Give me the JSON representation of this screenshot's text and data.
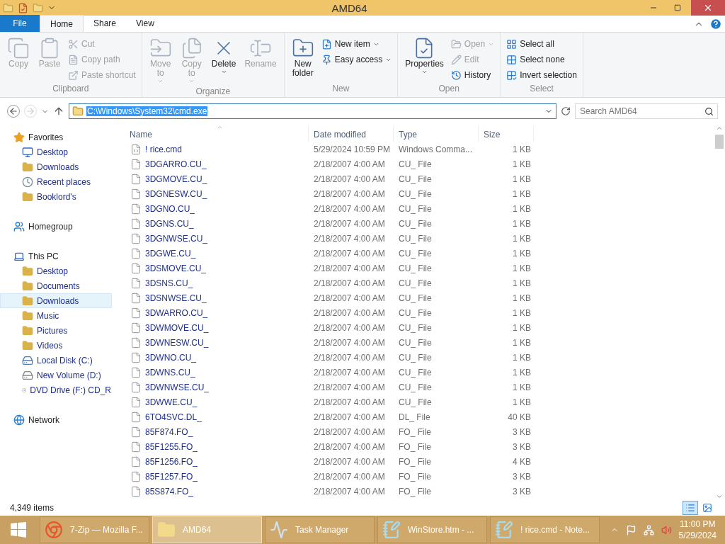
{
  "window": {
    "title": "AMD64"
  },
  "ribbon_tabs": [
    {
      "label": "File",
      "kind": "file",
      "selected": false
    },
    {
      "label": "Home",
      "kind": "tab",
      "selected": true
    },
    {
      "label": "Share",
      "kind": "tab",
      "selected": false
    },
    {
      "label": "View",
      "kind": "tab",
      "selected": false
    }
  ],
  "ribbon_groups": [
    {
      "label": "Clipboard",
      "items": [
        {
          "label": "Copy",
          "kind": "large",
          "disabled": true,
          "dropdown": false
        },
        {
          "label": "Paste",
          "kind": "large",
          "disabled": true,
          "dropdown": false
        },
        {
          "kind": "stack",
          "items": [
            {
              "label": "Cut",
              "disabled": true,
              "dropdown": false
            },
            {
              "label": "Copy path",
              "disabled": true,
              "dropdown": false
            },
            {
              "label": "Paste shortcut",
              "disabled": true,
              "dropdown": false
            }
          ]
        }
      ]
    },
    {
      "label": "Organize",
      "items": [
        {
          "label": "Move\nto",
          "kind": "large",
          "disabled": true,
          "dropdown": true
        },
        {
          "label": "Copy\nto",
          "kind": "large",
          "disabled": true,
          "dropdown": true
        },
        {
          "label": "Delete",
          "kind": "large",
          "disabled": false,
          "dropdown": true
        },
        {
          "label": "Rename",
          "kind": "large",
          "disabled": true,
          "dropdown": false
        }
      ]
    },
    {
      "label": "New",
      "items": [
        {
          "label": "New\nfolder",
          "kind": "large",
          "disabled": false,
          "dropdown": false
        },
        {
          "kind": "stack",
          "items": [
            {
              "label": "New item",
              "disabled": false,
              "dropdown": true
            },
            {
              "label": "Easy access",
              "disabled": false,
              "dropdown": true
            }
          ]
        }
      ]
    },
    {
      "label": "Open",
      "items": [
        {
          "label": "Properties",
          "kind": "large",
          "disabled": false,
          "dropdown": true
        },
        {
          "kind": "stack",
          "items": [
            {
              "label": "Open",
              "disabled": true,
              "dropdown": true
            },
            {
              "label": "Edit",
              "disabled": true,
              "dropdown": false
            },
            {
              "label": "History",
              "disabled": false,
              "dropdown": false
            }
          ]
        }
      ]
    },
    {
      "label": "Select",
      "items": [
        {
          "kind": "stack",
          "items": [
            {
              "label": "Select all",
              "disabled": false,
              "dropdown": false
            },
            {
              "label": "Select none",
              "disabled": false,
              "dropdown": false
            },
            {
              "label": "Invert selection",
              "disabled": false,
              "dropdown": false
            }
          ]
        }
      ]
    }
  ],
  "address": {
    "value": "C:\\Windows\\System32\\cmd.exe",
    "text_selected": true
  },
  "search": {
    "placeholder": "Search AMD64"
  },
  "nav": [
    {
      "label": "Favorites",
      "kind": "star",
      "selected": false,
      "children": [
        {
          "label": "Desktop",
          "kind": "desktop",
          "selected": false
        },
        {
          "label": "Downloads",
          "kind": "folder",
          "selected": false
        },
        {
          "label": "Recent places",
          "kind": "recent",
          "selected": false
        },
        {
          "label": "Booklord's",
          "kind": "folder",
          "selected": false
        }
      ]
    },
    {
      "label": "Homegroup",
      "kind": "homegroup",
      "selected": false
    },
    {
      "label": "This PC",
      "kind": "pc",
      "selected": false,
      "children": [
        {
          "label": "Desktop",
          "kind": "folder",
          "selected": false
        },
        {
          "label": "Documents",
          "kind": "folder",
          "selected": false
        },
        {
          "label": "Downloads",
          "kind": "folder",
          "selected": true
        },
        {
          "label": "Music",
          "kind": "folder",
          "selected": false
        },
        {
          "label": "Pictures",
          "kind": "folder",
          "selected": false
        },
        {
          "label": "Videos",
          "kind": "folder",
          "selected": false
        },
        {
          "label": "Local Disk (C:)",
          "kind": "disk",
          "selected": false
        },
        {
          "label": "New Volume (D:)",
          "kind": "drive",
          "selected": false
        },
        {
          "label": "DVD Drive (F:) CD_R",
          "kind": "dvd",
          "selected": false
        }
      ]
    },
    {
      "label": "Network",
      "kind": "network",
      "selected": false
    }
  ],
  "table": {
    "columns": [
      {
        "label": "Name",
        "sorted": true
      },
      {
        "label": "Date modified",
        "sorted": false
      },
      {
        "label": "Type",
        "sorted": false
      },
      {
        "label": "Size",
        "sorted": false
      }
    ],
    "rows": [
      {
        "kind": "script",
        "name": "! rice.cmd",
        "date": "5/29/2024 10:59 PM",
        "type": "Windows Comma...",
        "size": "1 KB"
      },
      {
        "kind": "file",
        "name": "3DGARRO.CU_",
        "date": "2/18/2007 4:00 AM",
        "type": "CU_ File",
        "size": "1 KB"
      },
      {
        "kind": "file",
        "name": "3DGMOVE.CU_",
        "date": "2/18/2007 4:00 AM",
        "type": "CU_ File",
        "size": "1 KB"
      },
      {
        "kind": "file",
        "name": "3DGNESW.CU_",
        "date": "2/18/2007 4:00 AM",
        "type": "CU_ File",
        "size": "1 KB"
      },
      {
        "kind": "file",
        "name": "3DGNO.CU_",
        "date": "2/18/2007 4:00 AM",
        "type": "CU_ File",
        "size": "1 KB"
      },
      {
        "kind": "file",
        "name": "3DGNS.CU_",
        "date": "2/18/2007 4:00 AM",
        "type": "CU_ File",
        "size": "1 KB"
      },
      {
        "kind": "file",
        "name": "3DGNWSE.CU_",
        "date": "2/18/2007 4:00 AM",
        "type": "CU_ File",
        "size": "1 KB"
      },
      {
        "kind": "file",
        "name": "3DGWE.CU_",
        "date": "2/18/2007 4:00 AM",
        "type": "CU_ File",
        "size": "1 KB"
      },
      {
        "kind": "file",
        "name": "3DSMOVE.CU_",
        "date": "2/18/2007 4:00 AM",
        "type": "CU_ File",
        "size": "1 KB"
      },
      {
        "kind": "file",
        "name": "3DSNS.CU_",
        "date": "2/18/2007 4:00 AM",
        "type": "CU_ File",
        "size": "1 KB"
      },
      {
        "kind": "file",
        "name": "3DSNWSE.CU_",
        "date": "2/18/2007 4:00 AM",
        "type": "CU_ File",
        "size": "1 KB"
      },
      {
        "kind": "file",
        "name": "3DWARRO.CU_",
        "date": "2/18/2007 4:00 AM",
        "type": "CU_ File",
        "size": "1 KB"
      },
      {
        "kind": "file",
        "name": "3DWMOVE.CU_",
        "date": "2/18/2007 4:00 AM",
        "type": "CU_ File",
        "size": "1 KB"
      },
      {
        "kind": "file",
        "name": "3DWNESW.CU_",
        "date": "2/18/2007 4:00 AM",
        "type": "CU_ File",
        "size": "1 KB"
      },
      {
        "kind": "file",
        "name": "3DWNO.CU_",
        "date": "2/18/2007 4:00 AM",
        "type": "CU_ File",
        "size": "1 KB"
      },
      {
        "kind": "file",
        "name": "3DWNS.CU_",
        "date": "2/18/2007 4:00 AM",
        "type": "CU_ File",
        "size": "1 KB"
      },
      {
        "kind": "file",
        "name": "3DWNWSE.CU_",
        "date": "2/18/2007 4:00 AM",
        "type": "CU_ File",
        "size": "1 KB"
      },
      {
        "kind": "file",
        "name": "3DWWE.CU_",
        "date": "2/18/2007 4:00 AM",
        "type": "CU_ File",
        "size": "1 KB"
      },
      {
        "kind": "file",
        "name": "6TO4SVC.DL_",
        "date": "2/18/2007 4:00 AM",
        "type": "DL_ File",
        "size": "40 KB"
      },
      {
        "kind": "file",
        "name": "85F874.FO_",
        "date": "2/18/2007 4:00 AM",
        "type": "FO_ File",
        "size": "3 KB"
      },
      {
        "kind": "file",
        "name": "85F1255.FO_",
        "date": "2/18/2007 4:00 AM",
        "type": "FO_ File",
        "size": "3 KB"
      },
      {
        "kind": "file",
        "name": "85F1256.FO_",
        "date": "2/18/2007 4:00 AM",
        "type": "FO_ File",
        "size": "4 KB"
      },
      {
        "kind": "file",
        "name": "85F1257.FO_",
        "date": "2/18/2007 4:00 AM",
        "type": "FO_ File",
        "size": "3 KB"
      },
      {
        "kind": "file",
        "name": "85S874.FO_",
        "date": "2/18/2007 4:00 AM",
        "type": "FO_ File",
        "size": "3 KB"
      }
    ]
  },
  "status_bar": {
    "text": "4,349 items",
    "details_view": true
  },
  "taskbar": {
    "buttons": [
      {
        "label": "7-Zip — Mozilla F...",
        "kind": "browser",
        "selected": false
      },
      {
        "label": "AMD64",
        "kind": "folder",
        "selected": true
      },
      {
        "label": "Task Manager",
        "kind": "monitor",
        "selected": false
      },
      {
        "label": "WinStore.htm - ...",
        "kind": "notepad",
        "selected": false
      },
      {
        "label": "! rice.cmd - Note...",
        "kind": "notepad",
        "selected": false
      }
    ],
    "time": "11:00 PM",
    "date": "5/29/2024"
  }
}
